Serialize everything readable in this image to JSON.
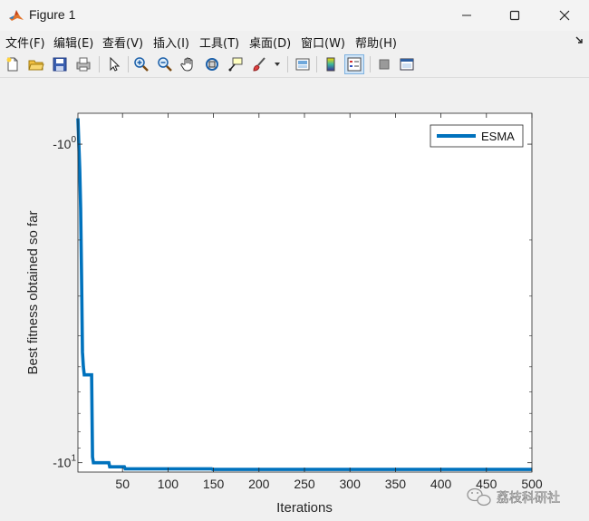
{
  "window": {
    "title": "Figure 1"
  },
  "menu": {
    "items": [
      {
        "id": "file",
        "label": "文件(F)"
      },
      {
        "id": "edit",
        "label": "编辑(E)"
      },
      {
        "id": "view",
        "label": "查看(V)"
      },
      {
        "id": "insert",
        "label": "插入(I)"
      },
      {
        "id": "tools",
        "label": "工具(T)"
      },
      {
        "id": "desktop",
        "label": "桌面(D)"
      },
      {
        "id": "window",
        "label": "窗口(W)"
      },
      {
        "id": "help",
        "label": "帮助(H)"
      }
    ]
  },
  "toolbar": {
    "buttons": [
      "new-figure",
      "open-file",
      "save",
      "print",
      "select-pointer",
      "zoom-in",
      "zoom-out",
      "pan",
      "rotate-3d",
      "data-cursor",
      "brush",
      "brush-dropdown",
      "link-plot",
      "colorbar",
      "legend",
      "hide-plot-tools",
      "show-plot-tools"
    ]
  },
  "watermark": {
    "text": "荔枝科研社"
  },
  "colors": {
    "series": "#0072bd",
    "axes": "#262626",
    "window_bg": "#f0f0f0"
  },
  "chart_data": {
    "type": "line",
    "title": "",
    "xlabel": "Iterations",
    "ylabel": "Best fitness obtained so far",
    "xlim": [
      1,
      500
    ],
    "yscale": "log",
    "y_sign": "negative",
    "ylim": [
      -10.7,
      -0.8
    ],
    "xticks": [
      50,
      100,
      150,
      200,
      250,
      300,
      350,
      400,
      450,
      500
    ],
    "xtick_labels": [
      "50",
      "100",
      "150",
      "200",
      "250",
      "300",
      "350",
      "400",
      "450",
      "500"
    ],
    "ytick_labels": [
      {
        "value": -1,
        "base": "-10",
        "exp": "0"
      },
      {
        "value": -10,
        "base": "-10",
        "exp": "1"
      }
    ],
    "grid": false,
    "legend_position": "top-right",
    "series": [
      {
        "name": "ESMA",
        "x": [
          1,
          2,
          3,
          4,
          5,
          6,
          7,
          8,
          16,
          17,
          18,
          35,
          36,
          52,
          53,
          148,
          149,
          300,
          500
        ],
        "y": [
          -0.83,
          -1.0,
          -1.2,
          -1.6,
          -2.6,
          -4.5,
          -5.0,
          -5.3,
          -5.3,
          -9.6,
          -10.0,
          -10.0,
          -10.3,
          -10.3,
          -10.45,
          -10.45,
          -10.5,
          -10.5,
          -10.5
        ]
      }
    ]
  }
}
